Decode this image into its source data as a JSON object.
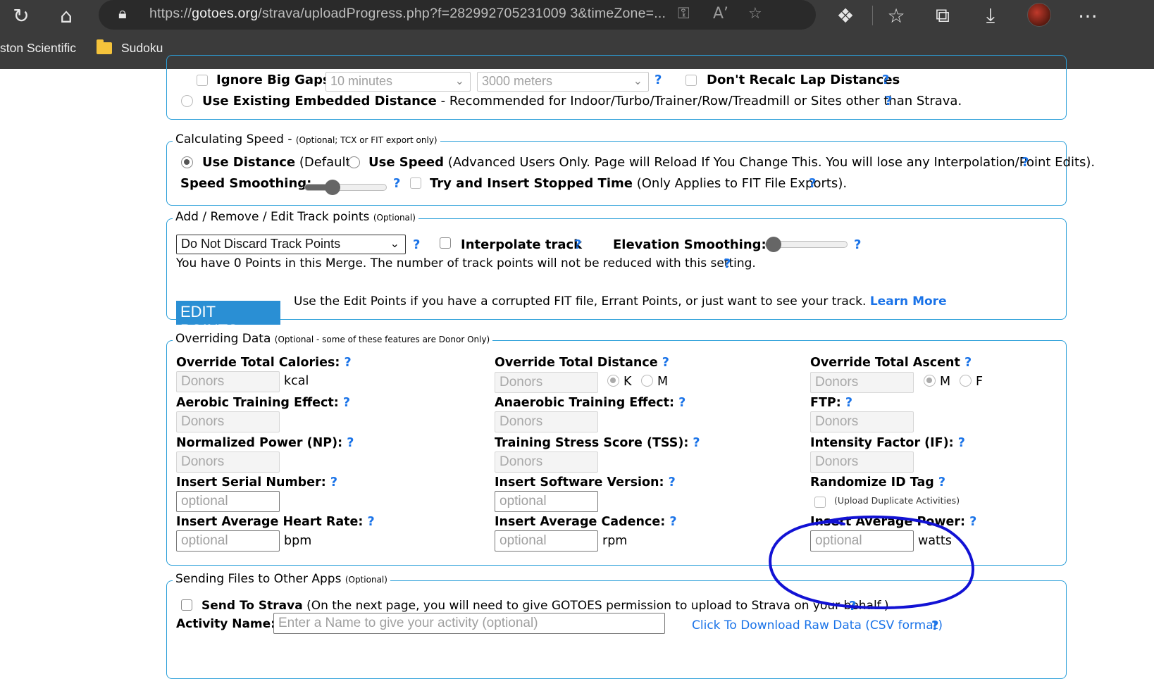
{
  "browser": {
    "url_prefix": "https://",
    "url_domain": "gotoes.org",
    "url_rest": "/strava/uploadProgress.php?f=282992705231009 3&timeZone=...",
    "bookmarks": [
      "ston Scientific",
      "Sudoku"
    ]
  },
  "gaps": {
    "ignore_big_gaps": "Ignore Big Gaps",
    "gap_time_select": "10 minutes",
    "gap_dist_select": "3000 meters",
    "dont_recalc": "Don't Recalc Lap Distances",
    "use_existing": "Use Existing Embedded Distance",
    "use_existing_desc": "- Recommended for Indoor/Turbo/Trainer/Row/Treadmill or Sites other than Strava."
  },
  "speed": {
    "legend": "Calculating Speed -",
    "legend_note": "(Optional; TCX or FIT export only)",
    "use_distance": "Use Distance",
    "use_distance_note": "(Default)",
    "use_speed": "Use Speed",
    "use_speed_note": "(Advanced Users Only. Page will Reload If You Change This. You will lose any Interpolation/Point Edits).",
    "smoothing_label": "Speed Smoothing:",
    "smoothing_value": 0.3,
    "stopped_time": "Try and Insert Stopped Time",
    "stopped_time_note": "(Only Applies to FIT File Exports)."
  },
  "track": {
    "legend": "Add / Remove / Edit Track points",
    "legend_note": "(Optional)",
    "discard_select": "Do Not Discard Track Points",
    "interpolate": "Interpolate track",
    "elev_smoothing": "Elevation Smoothing:",
    "elev_smoothing_value": 0,
    "points_msg": "You have 0 Points in this Merge. The number of track points will not be reduced with this setting.",
    "edit_points_btn": "EDIT POINTS",
    "edit_desc": "Use the Edit Points if you have a corrupted FIT file, Errant Points, or just want to see your track.",
    "learn_more": "Learn More"
  },
  "override": {
    "legend": "Overriding Data",
    "legend_note": "(Optional - some of these features are Donor Only)",
    "calories_label": "Override Total Calories:",
    "calories_unit": "kcal",
    "distance_label": "Override Total Distance",
    "dist_k": "K",
    "dist_m": "M",
    "ascent_label": "Override Total Ascent",
    "asc_m": "M",
    "asc_f": "F",
    "aerobic_label": "Aerobic Training Effect:",
    "anaerobic_label": "Anaerobic Training Effect:",
    "ftp_label": "FTP:",
    "np_label": "Normalized Power (NP):",
    "tss_label": "Training Stress Score (TSS):",
    "if_label": "Intensity Factor (IF):",
    "serial_label": "Insert Serial Number:",
    "software_label": "Insert Software Version:",
    "randomize_label": "Randomize ID Tag",
    "randomize_note": "(Upload Duplicate Activities)",
    "hr_label": "Insert Average Heart Rate:",
    "hr_unit": "bpm",
    "cadence_label": "Insert Average Cadence:",
    "cadence_unit": "rpm",
    "power_label": "Insert Average Power:",
    "power_unit": "watts",
    "donors_placeholder": "Donors",
    "optional_placeholder": "optional",
    "help": "?"
  },
  "sending": {
    "legend": "Sending Files to Other Apps",
    "legend_note": "(Optional)",
    "send_strava": "Send To Strava",
    "send_strava_note": "(On the next page, you will need to give GOTOES permission to upload to Strava on your behalf.)",
    "activity_name_label": "Activity Name:",
    "activity_name_placeholder": "Enter a Name to give your activity (optional)",
    "download_raw": "Click To Download Raw Data (CSV format)"
  },
  "colors": {
    "accent": "#1a73e8",
    "fieldset_border": "#2b9fd9",
    "edit_button": "#2a8fd4",
    "annotation": "#1212d4"
  }
}
